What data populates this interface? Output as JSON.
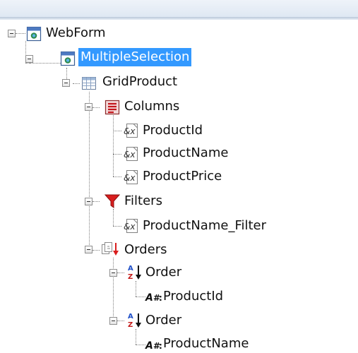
{
  "tree": {
    "nodes": {
      "webform": "WebForm",
      "multiple_selection": "MultipleSelection",
      "grid_product": "GridProduct",
      "columns": "Columns",
      "col_product_id": "ProductId",
      "col_product_name": "ProductName",
      "col_product_price": "ProductPrice",
      "filters": "Filters",
      "filter_product_name": "ProductName_Filter",
      "orders": "Orders",
      "order_1": "Order",
      "order_1_attr": "ProductId",
      "order_2": "Order",
      "order_2_attr": "ProductName"
    },
    "selected": "MultipleSelection"
  },
  "icons": {
    "webform": "webform-icon",
    "multiple_selection": "webcomponent-icon",
    "grid_product": "grid-icon",
    "columns": "columns-icon",
    "column": "variable-icon",
    "filters": "filter-funnel-icon",
    "orders": "orders-icon",
    "order": "sort-az-icon",
    "attribute": "attribute-icon"
  },
  "colors": {
    "selection": "#3399ff",
    "funnel": "#d91e1e",
    "toolbar": "#dfe8f3"
  }
}
